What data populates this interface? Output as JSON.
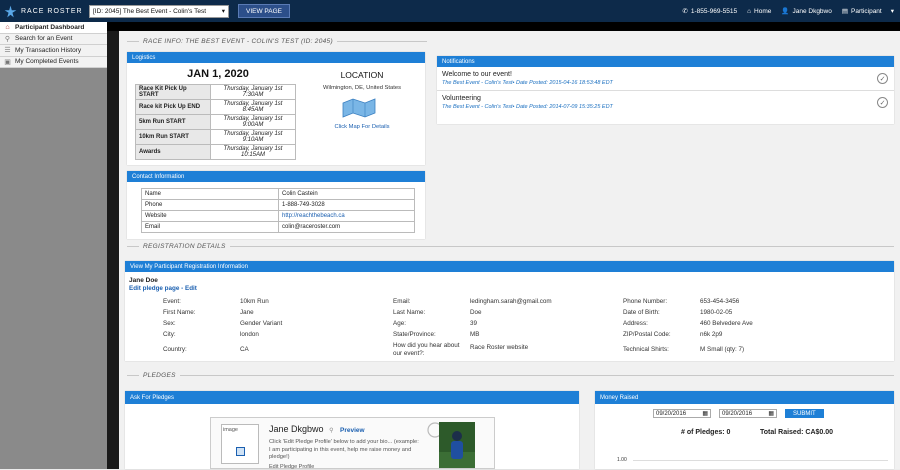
{
  "topbar": {
    "logo_text": "RACE ROSTER",
    "event_select": "[ID: 2045] The Best Event - Colin's Test",
    "view_page": "VIEW PAGE",
    "phone": "1-855-969-5515",
    "home": "Home",
    "user": "Jane Dkgbwo",
    "role": "Participant"
  },
  "sidebar": {
    "items": [
      {
        "label": "Participant Dashboard",
        "icon": "home-icon"
      },
      {
        "label": "Search for an Event",
        "icon": "search-icon"
      },
      {
        "label": "My Transaction History",
        "icon": "list-icon"
      },
      {
        "label": "My Completed Events",
        "icon": "document-icon"
      }
    ]
  },
  "race_info": {
    "title": "RACE INFO: THE BEST EVENT - COLIN'S TEST (ID: 2045)",
    "logistics_head": "Logistics",
    "date": "JAN 1, 2020",
    "location_head": "LOCATION",
    "location": "Wilmington, DE, United States",
    "map_link": "Click Map For Details",
    "schedule": [
      {
        "label": "Race Kit Pick Up START",
        "value": "Thursday, January 1st 7:30AM"
      },
      {
        "label": "Race kit Pick Up END",
        "value": "Thursday, January 1st 8:45AM"
      },
      {
        "label": "5km Run START",
        "value": "Thursday, January 1st 9:00AM"
      },
      {
        "label": "10km Run START",
        "value": "Thursday, January 1st 9:10AM"
      },
      {
        "label": "Awards",
        "value": "Thursday, January 1st 10:15AM"
      }
    ],
    "contact_head": "Contact Information",
    "contact": [
      {
        "label": "Name",
        "value": "Colin Castein"
      },
      {
        "label": "Phone",
        "value": "1-888-749-3028"
      },
      {
        "label": "Website",
        "value": "http://reachthebeach.ca"
      },
      {
        "label": "Email",
        "value": "colin@raceroster.com"
      }
    ]
  },
  "notifications": {
    "head": "Notifications",
    "items": [
      {
        "title": "Welcome to our event!",
        "sub": "The Best Event - Colin's Test• Date Posted: 2015-04-16 18:53:48 EDT"
      },
      {
        "title": "Volunteering",
        "sub": "The Best Event - Colin's Test• Date Posted: 2014-07-09 15:35:25 EDT"
      }
    ]
  },
  "registration": {
    "title": "REGISTRATION DETAILS",
    "head": "View My Participant Registration Information",
    "name": "Jane Doe",
    "edit_pledge": "Edit pledge page",
    "edit": "Edit",
    "col1": [
      {
        "label": "Event:",
        "value": "10km Run"
      },
      {
        "label": "First Name:",
        "value": "Jane"
      },
      {
        "label": "Sex:",
        "value": "Gender Variant"
      },
      {
        "label": "City:",
        "value": "london"
      },
      {
        "label": "Country:",
        "value": "CA"
      }
    ],
    "col2": [
      {
        "label": "Email:",
        "value": "ledingham.sarah@gmail.com"
      },
      {
        "label": "Last Name:",
        "value": "Doe"
      },
      {
        "label": "Age:",
        "value": "39"
      },
      {
        "label": "State/Province:",
        "value": "MB"
      },
      {
        "label": "How did you hear about our event?:",
        "value": "Race Roster website"
      }
    ],
    "col3": [
      {
        "label": "Phone Number:",
        "value": "653-454-3456"
      },
      {
        "label": "Date of Birth:",
        "value": "1980-02-05"
      },
      {
        "label": "Address:",
        "value": "460 Belvedere Ave"
      },
      {
        "label": "ZIP/Postal Code:",
        "value": "n6k 2p9"
      },
      {
        "label": "Technical Shirts:",
        "value": "M Small (qty: 7)"
      }
    ]
  },
  "pledges": {
    "title": "PLEDGES",
    "ask_head": "Ask For Pledges",
    "image_alt": "image",
    "pledge_name": "Jane Dkgbwo",
    "preview": "Preview",
    "bio": "Click 'Edit Pledge Profile' below to add your bio... (example: I am participating in this event, help me raise money and pledge!)",
    "edit_profile": "Edit Pledge Profile",
    "money_head": "Money Raised",
    "date_from": "09/20/2016",
    "date_to": "09/20/2016",
    "submit": "SUBMIT",
    "num_pledges": "# of Pledges: 0",
    "total_raised": "Total Raised:",
    "total_value": "CA$0.00",
    "chart_tick": "1.00"
  }
}
